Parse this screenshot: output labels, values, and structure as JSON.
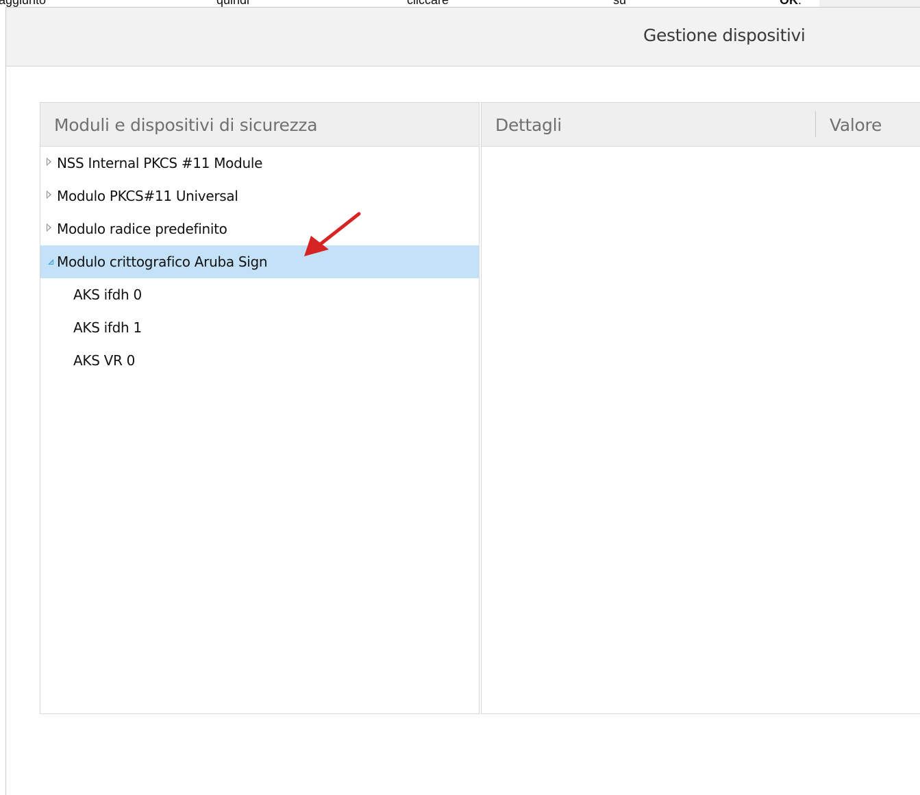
{
  "doc_text": {
    "words": [
      "aggiunto",
      "quindi",
      "cliccare",
      "su",
      "OK",
      "."
    ]
  },
  "dialog": {
    "title": "Gestione dispositivi"
  },
  "tree": {
    "column_header": "Moduli e dispositivi di sicurezza",
    "items": [
      {
        "label": "NSS Internal PKCS #11 Module",
        "state": "collapsed"
      },
      {
        "label": "Modulo PKCS#11 Universal",
        "state": "collapsed"
      },
      {
        "label": "Modulo radice predefinito",
        "state": "collapsed"
      },
      {
        "label": "Modulo crittografico Aruba Sign",
        "state": "expanded",
        "selected": true
      },
      {
        "label": "AKS ifdh 0",
        "state": "child"
      },
      {
        "label": "AKS ifdh 1",
        "state": "child"
      },
      {
        "label": "AKS VR 0",
        "state": "child"
      }
    ]
  },
  "details": {
    "column_details": "Dettagli",
    "column_value": "Valore"
  },
  "colors": {
    "selection": "#c3e2f7",
    "expanded_twisty": "#3ba2d8",
    "annotation_arrow": "#d62424"
  }
}
